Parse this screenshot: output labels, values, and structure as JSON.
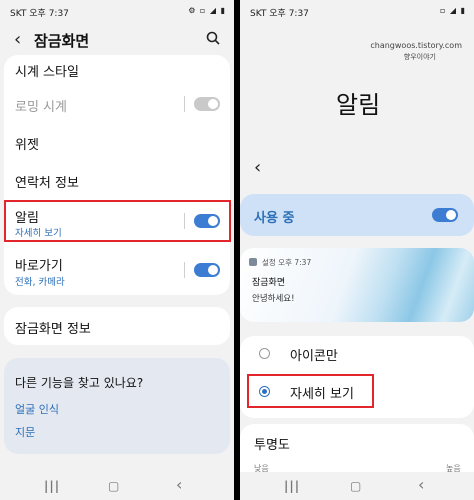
{
  "left": {
    "status": {
      "carrier_time": "SKT 오후 7:37",
      "right_icons": "⚙ ▫ ◢ ▮"
    },
    "header": {
      "title": "잠금화면"
    },
    "items": {
      "clock_style": "시계 스타일",
      "roaming_clock": "로밍 시계",
      "widget": "위젯",
      "contact": "연락처 정보",
      "notification": "알림",
      "notification_sub": "자세히 보기",
      "shortcut": "바로가기",
      "shortcut_sub": "전화, 카메라",
      "lockscreen_info": "잠금화면 정보"
    },
    "other": {
      "title": "다른 기능을 찾고 있나요?",
      "face": "얼굴 인식",
      "fingerprint": "지문"
    },
    "toggles": {
      "roaming_clock": false,
      "notification": true,
      "shortcut": true
    }
  },
  "right": {
    "status": {
      "carrier_time": "SKT 오후 7:37",
      "right_icons": "▫ ◢ ▮"
    },
    "watermark": {
      "line1": "changwoos.tistory.com",
      "line2": "향우이야기"
    },
    "title": "알림",
    "in_use": "사용 중",
    "in_use_toggle": true,
    "preview": {
      "app": "설정 오후 7:37",
      "title": "잠금화면",
      "message": "안녕하세요!"
    },
    "options": {
      "icon_only": "아이콘만",
      "detailed": "자세히 보기",
      "selected": "detailed"
    },
    "transparency": {
      "title": "투명도",
      "low": "낮음",
      "high": "높음"
    }
  },
  "colors": {
    "accent": "#3c7dd3",
    "highlight": "#e3262c",
    "bar": "#cfe1f7"
  }
}
